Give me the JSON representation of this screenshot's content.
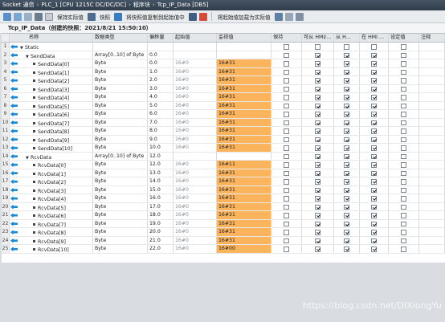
{
  "breadcrumb": [
    "Socket 通信",
    "PLC_1 [CPU 1215C DC/DC/DC]",
    "程序块",
    "Tcp_IP_Data [DB5]"
  ],
  "toolbar": {
    "keep_actual": "保持实际值",
    "snapshot": "快照",
    "copy_snapshot": "将快照值复制到起始值中",
    "load_start": "将起始值加载为实际值"
  },
  "block_title": "Tcp_IP_Data（创建的快照：2021/8/21 15:50:10）",
  "columns": [
    "名称",
    "数据类型",
    "偏移量",
    "起始值",
    "监视值",
    "保持",
    "可从 HMI/…",
    "从 H…",
    "在 HMI …",
    "设定值",
    "注释"
  ],
  "rows": [
    {
      "num": "1",
      "indent": 0,
      "expand": "▼",
      "name": "Static",
      "type": "",
      "offset": "",
      "start": "",
      "monitor": "",
      "keep": false,
      "hmi1": false,
      "hmi2": false,
      "hmi3": false,
      "set": false,
      "level": "header"
    },
    {
      "num": "2",
      "indent": 1,
      "expand": "▼",
      "name": "SendData",
      "type": "Array[0..10] of Byte",
      "offset": "0.0",
      "start": "",
      "monitor": "",
      "keep": false,
      "hmi1": true,
      "hmi2": true,
      "hmi3": true,
      "set": false,
      "level": "array"
    },
    {
      "num": "3",
      "indent": 2,
      "name": "SendData[0]",
      "type": "Byte",
      "offset": "0.0",
      "start": "16#0",
      "monitor": "16#31",
      "keep": false,
      "hmi1": true,
      "hmi2": true,
      "hmi3": true,
      "set": false
    },
    {
      "num": "4",
      "indent": 2,
      "name": "SendData[1]",
      "type": "Byte",
      "offset": "1.0",
      "start": "16#0",
      "monitor": "16#31",
      "keep": false,
      "hmi1": true,
      "hmi2": true,
      "hmi3": true,
      "set": false
    },
    {
      "num": "5",
      "indent": 2,
      "name": "SendData[2]",
      "type": "Byte",
      "offset": "2.0",
      "start": "16#0",
      "monitor": "16#31",
      "keep": false,
      "hmi1": true,
      "hmi2": true,
      "hmi3": true,
      "set": false
    },
    {
      "num": "6",
      "indent": 2,
      "name": "SendData[3]",
      "type": "Byte",
      "offset": "3.0",
      "start": "16#0",
      "monitor": "16#31",
      "keep": false,
      "hmi1": true,
      "hmi2": true,
      "hmi3": true,
      "set": false
    },
    {
      "num": "7",
      "indent": 2,
      "name": "SendData[4]",
      "type": "Byte",
      "offset": "4.0",
      "start": "16#0",
      "monitor": "16#31",
      "keep": false,
      "hmi1": true,
      "hmi2": true,
      "hmi3": true,
      "set": false
    },
    {
      "num": "8",
      "indent": 2,
      "name": "SendData[5]",
      "type": "Byte",
      "offset": "5.0",
      "start": "16#0",
      "monitor": "16#31",
      "keep": false,
      "hmi1": true,
      "hmi2": true,
      "hmi3": true,
      "set": false
    },
    {
      "num": "9",
      "indent": 2,
      "name": "SendData[6]",
      "type": "Byte",
      "offset": "6.0",
      "start": "16#0",
      "monitor": "16#31",
      "keep": false,
      "hmi1": true,
      "hmi2": true,
      "hmi3": true,
      "set": false
    },
    {
      "num": "10",
      "indent": 2,
      "name": "SendData[7]",
      "type": "Byte",
      "offset": "7.0",
      "start": "16#0",
      "monitor": "16#31",
      "keep": false,
      "hmi1": true,
      "hmi2": true,
      "hmi3": true,
      "set": false
    },
    {
      "num": "11",
      "indent": 2,
      "name": "SendData[8]",
      "type": "Byte",
      "offset": "8.0",
      "start": "16#0",
      "monitor": "16#31",
      "keep": false,
      "hmi1": true,
      "hmi2": true,
      "hmi3": true,
      "set": false
    },
    {
      "num": "12",
      "indent": 2,
      "name": "SendData[9]",
      "type": "Byte",
      "offset": "9.0",
      "start": "16#0",
      "monitor": "16#31",
      "keep": false,
      "hmi1": true,
      "hmi2": true,
      "hmi3": true,
      "set": false
    },
    {
      "num": "13",
      "indent": 2,
      "name": "SendData[10]",
      "type": "Byte",
      "offset": "10.0",
      "start": "16#0",
      "monitor": "16#31",
      "keep": false,
      "hmi1": true,
      "hmi2": true,
      "hmi3": true,
      "set": false
    },
    {
      "num": "14",
      "indent": 1,
      "expand": "▼",
      "name": "RcvData",
      "type": "Array[0..10] of Byte",
      "offset": "12.0",
      "start": "",
      "monitor": "",
      "keep": false,
      "hmi1": true,
      "hmi2": true,
      "hmi3": true,
      "set": false,
      "level": "array"
    },
    {
      "num": "15",
      "indent": 2,
      "name": "RcvData[0]",
      "type": "Byte",
      "offset": "12.0",
      "start": "16#0",
      "monitor": "16#11",
      "keep": false,
      "hmi1": true,
      "hmi2": true,
      "hmi3": true,
      "set": false
    },
    {
      "num": "16",
      "indent": 2,
      "name": "RcvData[1]",
      "type": "Byte",
      "offset": "13.0",
      "start": "16#0",
      "monitor": "16#31",
      "keep": false,
      "hmi1": true,
      "hmi2": true,
      "hmi3": true,
      "set": false
    },
    {
      "num": "17",
      "indent": 2,
      "name": "RcvData[2]",
      "type": "Byte",
      "offset": "14.0",
      "start": "16#0",
      "monitor": "16#31",
      "keep": false,
      "hmi1": true,
      "hmi2": true,
      "hmi3": true,
      "set": false
    },
    {
      "num": "18",
      "indent": 2,
      "name": "RcvData[3]",
      "type": "Byte",
      "offset": "15.0",
      "start": "16#0",
      "monitor": "16#31",
      "keep": false,
      "hmi1": true,
      "hmi2": true,
      "hmi3": true,
      "set": false
    },
    {
      "num": "19",
      "indent": 2,
      "name": "RcvData[4]",
      "type": "Byte",
      "offset": "16.0",
      "start": "16#0",
      "monitor": "16#31",
      "keep": false,
      "hmi1": true,
      "hmi2": true,
      "hmi3": true,
      "set": false
    },
    {
      "num": "20",
      "indent": 2,
      "name": "RcvData[5]",
      "type": "Byte",
      "offset": "17.0",
      "start": "16#0",
      "monitor": "16#31",
      "keep": false,
      "hmi1": true,
      "hmi2": true,
      "hmi3": true,
      "set": false
    },
    {
      "num": "21",
      "indent": 2,
      "name": "RcvData[6]",
      "type": "Byte",
      "offset": "18.0",
      "start": "16#0",
      "monitor": "16#31",
      "keep": false,
      "hmi1": true,
      "hmi2": true,
      "hmi3": true,
      "set": false
    },
    {
      "num": "22",
      "indent": 2,
      "name": "RcvData[7]",
      "type": "Byte",
      "offset": "19.0",
      "start": "16#0",
      "monitor": "16#31",
      "keep": false,
      "hmi1": true,
      "hmi2": true,
      "hmi3": true,
      "set": false
    },
    {
      "num": "23",
      "indent": 2,
      "name": "RcvData[8]",
      "type": "Byte",
      "offset": "20.0",
      "start": "16#0",
      "monitor": "16#31",
      "keep": false,
      "hmi1": true,
      "hmi2": true,
      "hmi3": true,
      "set": false
    },
    {
      "num": "24",
      "indent": 2,
      "name": "RcvData[9]",
      "type": "Byte",
      "offset": "21.0",
      "start": "16#0",
      "monitor": "16#31",
      "keep": false,
      "hmi1": true,
      "hmi2": true,
      "hmi3": true,
      "set": false
    },
    {
      "num": "25",
      "indent": 2,
      "name": "RcvData[10]",
      "type": "Byte",
      "offset": "22.0",
      "start": "16#0",
      "monitor": "16#00",
      "keep": false,
      "hmi1": true,
      "hmi2": true,
      "hmi3": true,
      "set": false
    }
  ],
  "watermark": "https://blog.csdn.net/DIXiongYu",
  "colors": {
    "monitor_bg": "#fbb45c",
    "icon_blue": "#1689d8",
    "titlebar": "#3a4858"
  }
}
